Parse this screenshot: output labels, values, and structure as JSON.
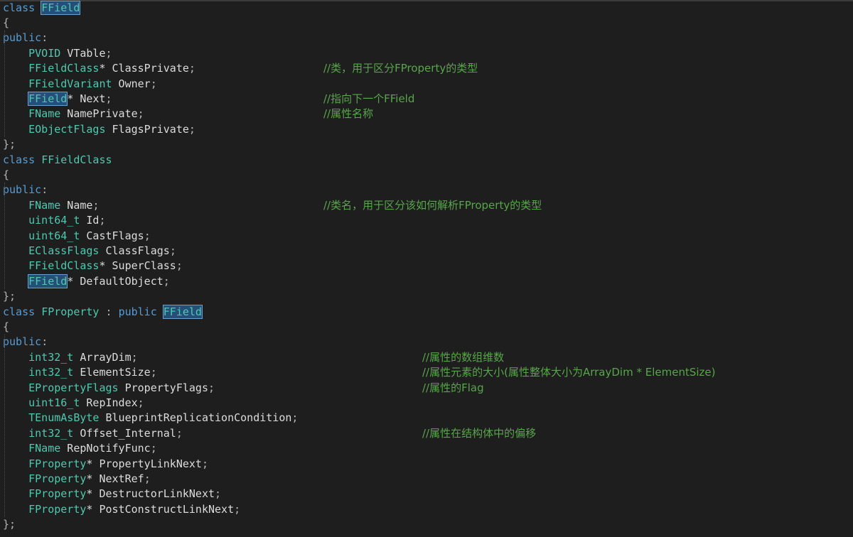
{
  "editor": {
    "lines": [
      {
        "segments": [
          {
            "t": "class",
            "c": "kw"
          },
          {
            "t": " ",
            "c": "id"
          },
          {
            "t": "FField",
            "c": "ty",
            "hl": true
          }
        ],
        "comment": ""
      },
      {
        "segments": [
          {
            "t": "{",
            "c": "pn"
          }
        ],
        "comment": ""
      },
      {
        "segments": [
          {
            "t": "public",
            "c": "kw"
          },
          {
            "t": ":",
            "c": "pn"
          }
        ],
        "comment": ""
      },
      {
        "segments": [
          {
            "t": "    ",
            "c": "id"
          },
          {
            "t": "PVOID",
            "c": "ty"
          },
          {
            "t": " VTable",
            "c": "id"
          },
          {
            "t": ";",
            "c": "pn"
          }
        ],
        "comment": ""
      },
      {
        "segments": [
          {
            "t": "    ",
            "c": "id"
          },
          {
            "t": "FFieldClass",
            "c": "ty"
          },
          {
            "t": "* ClassPrivate",
            "c": "id"
          },
          {
            "t": ";",
            "c": "pn"
          }
        ],
        "comment": "//类，用于区分FProperty的类型",
        "ccol": 455
      },
      {
        "segments": [
          {
            "t": "    ",
            "c": "id"
          },
          {
            "t": "FFieldVariant",
            "c": "ty"
          },
          {
            "t": " Owner",
            "c": "id"
          },
          {
            "t": ";",
            "c": "pn"
          }
        ],
        "comment": ""
      },
      {
        "segments": [
          {
            "t": "    ",
            "c": "id"
          },
          {
            "t": "FField",
            "c": "ty",
            "hl": true
          },
          {
            "t": "* Next",
            "c": "id"
          },
          {
            "t": ";",
            "c": "pn"
          }
        ],
        "comment": "//指向下一个FField",
        "ccol": 455
      },
      {
        "segments": [
          {
            "t": "    ",
            "c": "id"
          },
          {
            "t": "FName",
            "c": "ty"
          },
          {
            "t": " NamePrivate",
            "c": "id"
          },
          {
            "t": ";",
            "c": "pn"
          }
        ],
        "comment": "//属性名称",
        "ccol": 455
      },
      {
        "segments": [
          {
            "t": "    ",
            "c": "id"
          },
          {
            "t": "EObjectFlags",
            "c": "ty"
          },
          {
            "t": " FlagsPrivate",
            "c": "id"
          },
          {
            "t": ";",
            "c": "pn"
          }
        ],
        "comment": ""
      },
      {
        "segments": [
          {
            "t": "};",
            "c": "pn"
          }
        ],
        "comment": ""
      },
      {
        "segments": [
          {
            "t": "class",
            "c": "kw"
          },
          {
            "t": " ",
            "c": "id"
          },
          {
            "t": "FFieldClass",
            "c": "ty"
          }
        ],
        "comment": ""
      },
      {
        "segments": [
          {
            "t": "{",
            "c": "pn"
          }
        ],
        "comment": ""
      },
      {
        "segments": [
          {
            "t": "public",
            "c": "kw"
          },
          {
            "t": ":",
            "c": "pn"
          }
        ],
        "comment": ""
      },
      {
        "segments": [
          {
            "t": "    ",
            "c": "id"
          },
          {
            "t": "FName",
            "c": "ty"
          },
          {
            "t": " Name",
            "c": "id"
          },
          {
            "t": ";",
            "c": "pn"
          }
        ],
        "comment": "//类名，用于区分该如何解析FProperty的类型",
        "ccol": 455
      },
      {
        "segments": [
          {
            "t": "    ",
            "c": "id"
          },
          {
            "t": "uint64_t",
            "c": "ty"
          },
          {
            "t": " Id",
            "c": "id"
          },
          {
            "t": ";",
            "c": "pn"
          }
        ],
        "comment": ""
      },
      {
        "segments": [
          {
            "t": "    ",
            "c": "id"
          },
          {
            "t": "uint64_t",
            "c": "ty"
          },
          {
            "t": " CastFlags",
            "c": "id"
          },
          {
            "t": ";",
            "c": "pn"
          }
        ],
        "comment": ""
      },
      {
        "segments": [
          {
            "t": "    ",
            "c": "id"
          },
          {
            "t": "EClassFlags",
            "c": "ty"
          },
          {
            "t": " ClassFlags",
            "c": "id"
          },
          {
            "t": ";",
            "c": "pn"
          }
        ],
        "comment": ""
      },
      {
        "segments": [
          {
            "t": "    ",
            "c": "id"
          },
          {
            "t": "FFieldClass",
            "c": "ty"
          },
          {
            "t": "* SuperClass",
            "c": "id"
          },
          {
            "t": ";",
            "c": "pn"
          }
        ],
        "comment": ""
      },
      {
        "segments": [
          {
            "t": "    ",
            "c": "id"
          },
          {
            "t": "FField",
            "c": "ty",
            "hl": true
          },
          {
            "t": "* DefaultObject",
            "c": "id"
          },
          {
            "t": ";",
            "c": "pn"
          }
        ],
        "comment": ""
      },
      {
        "segments": [
          {
            "t": "};",
            "c": "pn"
          }
        ],
        "comment": ""
      },
      {
        "segments": [
          {
            "t": "class",
            "c": "kw"
          },
          {
            "t": " ",
            "c": "id"
          },
          {
            "t": "FProperty",
            "c": "ty"
          },
          {
            "t": " : ",
            "c": "pn"
          },
          {
            "t": "public",
            "c": "kw"
          },
          {
            "t": " ",
            "c": "id"
          },
          {
            "t": "FField",
            "c": "ty",
            "hl": true
          }
        ],
        "comment": ""
      },
      {
        "segments": [
          {
            "t": "{",
            "c": "pn"
          }
        ],
        "comment": ""
      },
      {
        "segments": [
          {
            "t": "public",
            "c": "kw"
          },
          {
            "t": ":",
            "c": "pn"
          }
        ],
        "comment": ""
      },
      {
        "segments": [
          {
            "t": "    ",
            "c": "id"
          },
          {
            "t": "int32_t",
            "c": "ty"
          },
          {
            "t": " ArrayDim",
            "c": "id"
          },
          {
            "t": ";",
            "c": "pn"
          }
        ],
        "comment": "//属性的数组维数",
        "ccol": 594
      },
      {
        "segments": [
          {
            "t": "    ",
            "c": "id"
          },
          {
            "t": "int32_t",
            "c": "ty"
          },
          {
            "t": " ElementSize",
            "c": "id"
          },
          {
            "t": ";",
            "c": "pn"
          }
        ],
        "comment": "//属性元素的大小(属性整体大小为ArrayDim * ElementSize)",
        "ccol": 594
      },
      {
        "segments": [
          {
            "t": "    ",
            "c": "id"
          },
          {
            "t": "EPropertyFlags",
            "c": "ty"
          },
          {
            "t": " PropertyFlags",
            "c": "id"
          },
          {
            "t": ";",
            "c": "pn"
          }
        ],
        "comment": "//属性的Flag",
        "ccol": 594
      },
      {
        "segments": [
          {
            "t": "    ",
            "c": "id"
          },
          {
            "t": "uint16_t",
            "c": "ty"
          },
          {
            "t": " RepIndex",
            "c": "id"
          },
          {
            "t": ";",
            "c": "pn"
          }
        ],
        "comment": ""
      },
      {
        "segments": [
          {
            "t": "    ",
            "c": "id"
          },
          {
            "t": "TEnumAsByte",
            "c": "ty"
          },
          {
            "t": " BlueprintReplicationCondition",
            "c": "id"
          },
          {
            "t": ";",
            "c": "pn"
          }
        ],
        "comment": ""
      },
      {
        "segments": [
          {
            "t": "    ",
            "c": "id"
          },
          {
            "t": "int32_t",
            "c": "ty"
          },
          {
            "t": " Offset_Internal",
            "c": "id"
          },
          {
            "t": ";",
            "c": "pn"
          }
        ],
        "comment": "//属性在结构体中的偏移",
        "ccol": 594
      },
      {
        "segments": [
          {
            "t": "    ",
            "c": "id"
          },
          {
            "t": "FName",
            "c": "ty"
          },
          {
            "t": " RepNotifyFunc",
            "c": "id"
          },
          {
            "t": ";",
            "c": "pn"
          }
        ],
        "comment": ""
      },
      {
        "segments": [
          {
            "t": "    ",
            "c": "id"
          },
          {
            "t": "FProperty",
            "c": "ty"
          },
          {
            "t": "* PropertyLinkNext",
            "c": "id"
          },
          {
            "t": ";",
            "c": "pn"
          }
        ],
        "comment": ""
      },
      {
        "segments": [
          {
            "t": "    ",
            "c": "id"
          },
          {
            "t": "FProperty",
            "c": "ty"
          },
          {
            "t": "* NextRef",
            "c": "id"
          },
          {
            "t": ";",
            "c": "pn"
          }
        ],
        "comment": ""
      },
      {
        "segments": [
          {
            "t": "    ",
            "c": "id"
          },
          {
            "t": "FProperty",
            "c": "ty"
          },
          {
            "t": "* DestructorLinkNext",
            "c": "id"
          },
          {
            "t": ";",
            "c": "pn"
          }
        ],
        "comment": ""
      },
      {
        "segments": [
          {
            "t": "    ",
            "c": "id"
          },
          {
            "t": "FProperty",
            "c": "ty"
          },
          {
            "t": "* PostConstructLinkNext",
            "c": "id"
          },
          {
            "t": ";",
            "c": "pn"
          }
        ],
        "comment": ""
      },
      {
        "segments": [
          {
            "t": "};",
            "c": "pn"
          }
        ],
        "comment": ""
      }
    ]
  },
  "colors": {
    "background": "#1e1e1e",
    "keyword": "#569cd6",
    "type": "#4ec9b0",
    "identifier": "#dcdcdc",
    "comment": "#57a64a",
    "highlight": "#264f78"
  }
}
